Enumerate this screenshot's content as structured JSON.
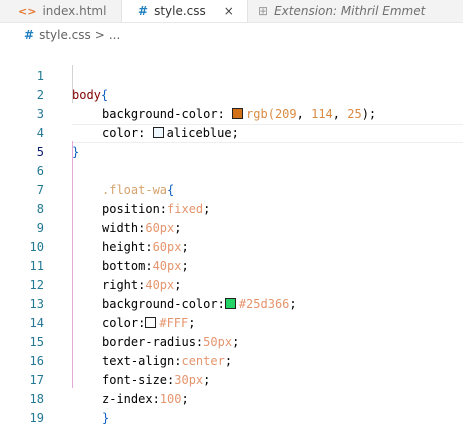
{
  "tabs": [
    {
      "icon": "<>",
      "label": "index.html"
    },
    {
      "icon": "#",
      "label": "style.css",
      "close": "×"
    },
    {
      "icon": "⊞",
      "label": "Extension: Mithril Emmet"
    }
  ],
  "breadcrumb": {
    "file": "style.css",
    "sep": ">",
    "more": "..."
  },
  "line_numbers": [
    "1",
    "2",
    "3",
    "4",
    "5",
    "6",
    "7",
    "8",
    "9",
    "10",
    "11",
    "12",
    "13",
    "14",
    "15",
    "16",
    "17",
    "18",
    "19"
  ],
  "colors": {
    "swatch_orange": "#d17219",
    "swatch_green": "#25d366",
    "swatch_white": "#FFFFFF"
  },
  "code": {
    "l1": {
      "sel": "body",
      "brace": "{"
    },
    "l2": {
      "prop": "background-color: ",
      "fn": "rgb(",
      "n1": "209",
      "c1": ", ",
      "n2": "114",
      "c2": ", ",
      "n3": "25",
      "end": ");"
    },
    "l3": {
      "prop": "color: ",
      "val": "aliceblue;"
    },
    "l4": {
      "brace": "}"
    },
    "l6": {
      "sel": ".float-wa",
      "brace": "{"
    },
    "l7": {
      "prop": "position:",
      "val": "fixed",
      "semi": ";"
    },
    "l8": {
      "prop": "width:",
      "val": "60px",
      "semi": ";"
    },
    "l9": {
      "prop": "height:",
      "val": "60px",
      "semi": ";"
    },
    "l10": {
      "prop": "bottom:",
      "val": "40px",
      "semi": ";"
    },
    "l11": {
      "prop": "right:",
      "val": "40px",
      "semi": ";"
    },
    "l12": {
      "prop": "background-color:",
      "val": "#25d366",
      "semi": ";"
    },
    "l13": {
      "prop": "color:",
      "val": "#FFF",
      "semi": ";"
    },
    "l14": {
      "prop": "border-radius:",
      "val": "50px",
      "semi": ";"
    },
    "l15": {
      "prop": "text-align:",
      "val": "center",
      "semi": ";"
    },
    "l16": {
      "prop": "font-size:",
      "val": "30px",
      "semi": ";"
    },
    "l17": {
      "prop": "z-index:",
      "val": "100",
      "semi": ";"
    },
    "l18": {
      "brace": "}"
    }
  }
}
